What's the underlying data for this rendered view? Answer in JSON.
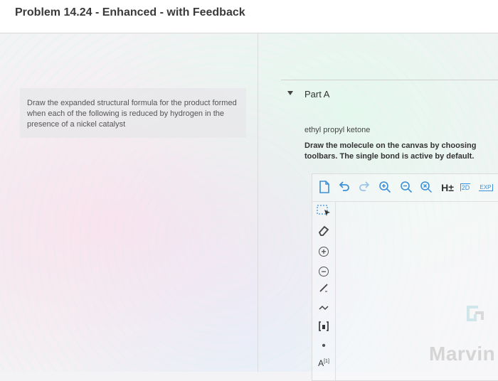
{
  "header": {
    "title": "Problem 14.24 - Enhanced - with Feedback"
  },
  "instructions": {
    "text": "Draw the expanded structural formula for the product formed when each of the following is reduced by hydrogen in the presence of a nickel catalyst"
  },
  "part": {
    "label": "Part A",
    "compound": "ethyl propyl ketone",
    "instruction_line1": "Draw the molecule on the canvas by choosing",
    "instruction_line2": "toolbars. The single bond is active by default."
  },
  "toolbar": {
    "h_label": "H±",
    "twod_label": "2D",
    "exp_label": "EXP"
  },
  "left_toolbar": {
    "abbrev_label": "A",
    "abbrev_sub": "[1]"
  },
  "brand": {
    "name": "Marvin"
  },
  "colors": {
    "accent": "#3b8fd6",
    "brand_watermark": "#d5d5d5"
  }
}
